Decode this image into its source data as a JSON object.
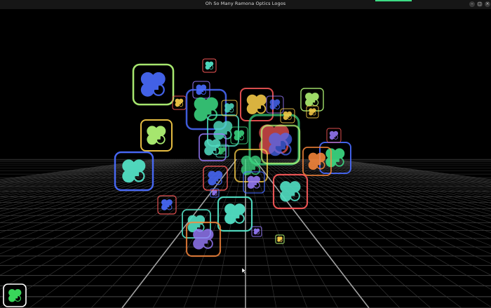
{
  "window": {
    "title": "Oh So Many Ramona Optics Logos",
    "accent_color": "#3ddc84",
    "controls": [
      {
        "name": "minimize",
        "glyph": "–"
      },
      {
        "name": "maximize",
        "glyph": "□"
      },
      {
        "name": "close",
        "glyph": "×"
      }
    ]
  },
  "scene": {
    "background": "#000000",
    "grid_color": "#3a3a3a",
    "grid_highlight": "#bdbdbd",
    "logo_icon": "ramona-optics-logo-icon",
    "palette": [
      "#3ddc84",
      "#ff5b5b",
      "#ffd24a",
      "#52e0c4",
      "#4a6cff",
      "#9a7dff",
      "#ff8a3d",
      "#b9ff7a"
    ]
  },
  "app_icon": {
    "icon": "ramona-optics-logo-icon",
    "dot_color": "#38d65a",
    "border_color": "#ffffff"
  }
}
